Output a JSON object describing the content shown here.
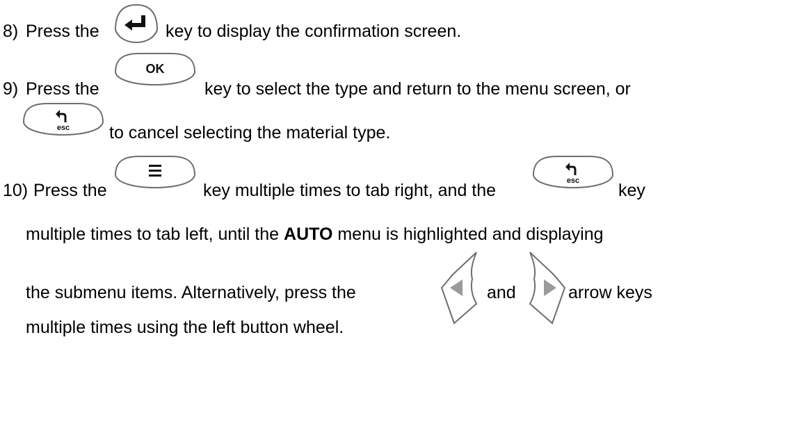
{
  "steps": [
    {
      "number": "8)",
      "pre": "Press the",
      "post": "key to display the confirmation screen."
    },
    {
      "number": "9)",
      "pre": "Press the",
      "post": "key to select the type and return to the menu screen, or",
      "line2": "to cancel selecting the material type."
    },
    {
      "number": "10)",
      "pre": "Press the",
      "mid": "key multiple times to tab right, and the",
      "end": "key",
      "line2_pre": "multiple times to tab left, until the",
      "line2_bold": "AUTO",
      "line2_post": "menu is highlighted and displaying",
      "line3_pre": "the submenu items.  Alternatively, press the",
      "line3_and": "and",
      "line3_post": "arrow keys",
      "line4": "multiple times using the left button wheel."
    }
  ],
  "keys": {
    "ok_label": "OK",
    "esc_label": "esc",
    "icons": [
      "enter-key",
      "ok-key",
      "esc-key",
      "menu-key",
      "left-arrow-key",
      "right-arrow-key"
    ]
  },
  "colors": {
    "text": "#000000",
    "key_outline": "#6e6e6e",
    "key_glyph": "#111111",
    "arrow_fill": "#9a9a9a"
  }
}
